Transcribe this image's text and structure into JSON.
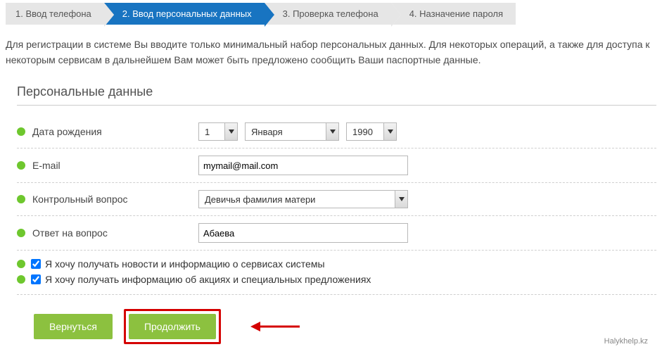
{
  "steps": [
    {
      "label": "1. Ввод телефона",
      "active": false
    },
    {
      "label": "2. Ввод персональных данных",
      "active": true
    },
    {
      "label": "3. Проверка телефона",
      "active": false
    },
    {
      "label": "4. Назначение пароля",
      "active": false
    }
  ],
  "intro": "Для регистрации в системе Вы вводите только минимальный набор персональных данных. Для некоторых операций, а также для доступа к некоторым сервисам в дальнейшем Вам может быть предложено сообщить Ваши паспортные данные.",
  "section_title": "Персональные данные",
  "fields": {
    "dob": {
      "label": "Дата рождения",
      "day": "1",
      "month": "Января",
      "year": "1990"
    },
    "email": {
      "label": "E-mail",
      "value": "mymail@mail.com"
    },
    "question": {
      "label": "Контрольный вопрос",
      "value": "Девичья фамилия матери"
    },
    "answer": {
      "label": "Ответ на вопрос",
      "value": "Абаева"
    }
  },
  "checkboxes": {
    "news": {
      "checked": true,
      "label": "Я хочу получать новости и информацию о сервисах системы"
    },
    "promo": {
      "checked": true,
      "label": "Я хочу получать информацию об акциях и специальных предложениях"
    }
  },
  "buttons": {
    "back": "Вернуться",
    "continue": "Продолжить"
  },
  "colors": {
    "accent_green": "#8cc13f",
    "step_active": "#1874c1",
    "highlight_red": "#d40000"
  },
  "watermark": "Halykhelp.kz"
}
